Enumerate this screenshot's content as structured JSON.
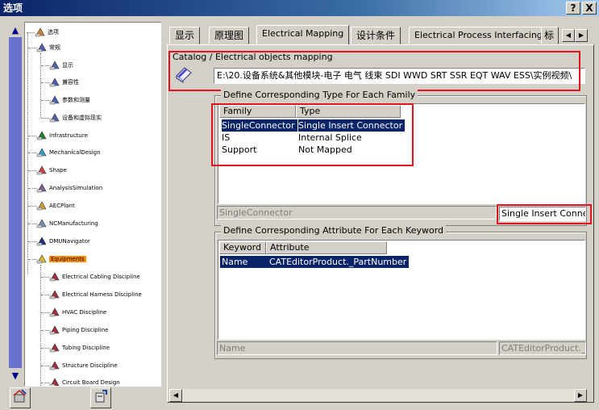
{
  "window": {
    "title": "选项",
    "help_label": "?",
    "close_label": "X"
  },
  "tree": {
    "items": [
      {
        "label": "选项",
        "icon": "options-icon",
        "color": "#d08030"
      },
      {
        "label": "常规",
        "icon": "general-icon",
        "color": "#5060b0"
      },
      {
        "label": "显示",
        "icon": "display-icon",
        "color": "#5060b0"
      },
      {
        "label": "兼容性",
        "icon": "compatibility-icon",
        "color": "#5060b0"
      },
      {
        "label": "参数和测量",
        "icon": "parameters-icon",
        "color": "#5060b0"
      },
      {
        "label": "设备和虚拟现实",
        "icon": "devices-icon",
        "color": "#5060b0"
      },
      {
        "label": "Infrastructure",
        "icon": "infrastructure-icon",
        "color": "#208030"
      },
      {
        "label": "MechanicalDesign",
        "icon": "mechanical-design-icon",
        "color": "#30a0d0"
      },
      {
        "label": "Shape",
        "icon": "shape-icon",
        "color": "#d04040"
      },
      {
        "label": "AnalysisSimulation",
        "icon": "analysis-icon",
        "color": "#806090"
      },
      {
        "label": "AECPlant",
        "icon": "aec-plant-icon",
        "color": "#d0a030"
      },
      {
        "label": "NCManufacturing",
        "icon": "nc-manufacturing-icon",
        "color": "#7090b0"
      },
      {
        "label": "DMUNavigator",
        "icon": "dmu-navigator-icon",
        "color": "#203080"
      },
      {
        "label": "Equipments",
        "icon": "equipments-icon",
        "color": "#e0c020"
      },
      {
        "label": "Electrical Cabling Discipline",
        "icon": "cabling-icon",
        "color": "#a03040"
      },
      {
        "label": "Electrical Harness Discipline",
        "icon": "harness-icon",
        "color": "#a03040"
      },
      {
        "label": "HVAC Discipline",
        "icon": "hvac-icon",
        "color": "#a03040"
      },
      {
        "label": "Piping Discipline",
        "icon": "piping-icon",
        "color": "#a03040"
      },
      {
        "label": "Tubing Discipline",
        "icon": "tubing-icon",
        "color": "#a03040"
      },
      {
        "label": "Structure Discipline",
        "icon": "structure-icon",
        "color": "#a03040"
      },
      {
        "label": "Circuit Board Design",
        "icon": "circuit-board-icon",
        "color": "#a03040"
      }
    ],
    "selected": "Equipments"
  },
  "tabs": [
    {
      "label": "显示"
    },
    {
      "label": "原理图"
    },
    {
      "label": "Electrical Mapping"
    },
    {
      "label": "设计条件"
    },
    {
      "label": "Electrical Process Interfacing"
    },
    {
      "label": "标"
    }
  ],
  "active_tab": "Electrical Mapping",
  "catalog": {
    "label": "Catalog / Electrical objects mapping",
    "path": "E:\\20.设备系统&其他模块-电子 电气 线束 SDI WWD SRT SSR EQT WAV ESS\\实例视频\\",
    "icon": "catalog-book-icon"
  },
  "type_group": {
    "title": "Define Corresponding Type For Each Family",
    "columns": [
      "Family",
      "Type"
    ],
    "rows": [
      [
        "SingleConnector",
        "Single Insert Connector"
      ],
      [
        "IS",
        "Internal Splice"
      ],
      [
        "Support",
        "Not Mapped"
      ]
    ],
    "selected_family": "SingleConnector",
    "selected_type": "Single Insert Connector"
  },
  "attribute_group": {
    "title": "Define Corresponding Attribute For Each Keyword",
    "columns": [
      "Keyword",
      "Attribute"
    ],
    "rows": [
      [
        "Name",
        "CATEditorProduct._PartNumber"
      ]
    ],
    "keyword_field": "Name",
    "attribute_field": "CATEditorProduct._P"
  },
  "colors": {
    "title_bar": "#0a246a",
    "selection": "#0a246a",
    "highlight_box": "#e0141e",
    "tree_selection": "#ff8c00"
  }
}
